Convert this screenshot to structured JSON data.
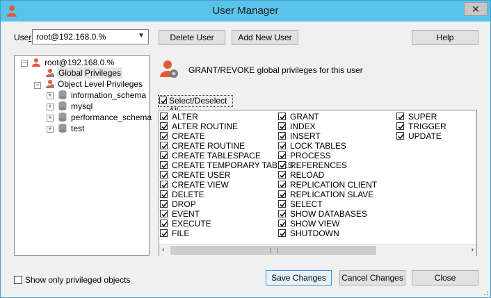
{
  "window": {
    "title": "User Manager",
    "close_label": "✕"
  },
  "user": {
    "label_pre": "Use",
    "label_u": "r",
    "selected": "root@192.168.0.%"
  },
  "buttons": {
    "delete_user": "Delete User",
    "add_new_user": "Add New User",
    "help": "Help",
    "save_changes": "Save Changes",
    "cancel_changes": "Cancel Changes",
    "close": "Close"
  },
  "tree": {
    "root": "root@192.168.0.%",
    "global": "Global Privileges",
    "object_level": "Object Level Privileges",
    "databases": [
      "information_schema",
      "mysql",
      "performance_schema",
      "test"
    ]
  },
  "header": {
    "text": "GRANT/REVOKE global privileges for this user"
  },
  "select_all": {
    "label": "Select/Deselect All",
    "checked": true
  },
  "privileges": {
    "col1": [
      "ALTER",
      "ALTER ROUTINE",
      "CREATE",
      "CREATE ROUTINE",
      "CREATE TABLESPACE",
      "CREATE TEMPORARY TABLES",
      "CREATE USER",
      "CREATE VIEW",
      "DELETE",
      "DROP",
      "EVENT",
      "EXECUTE",
      "FILE"
    ],
    "col2": [
      "GRANT",
      "INDEX",
      "INSERT",
      "LOCK TABLES",
      "PROCESS",
      "REFERENCES",
      "RELOAD",
      "REPLICATION CLIENT",
      "REPLICATION SLAVE",
      "SELECT",
      "SHOW DATABASES",
      "SHOW VIEW",
      "SHUTDOWN"
    ],
    "col3": [
      "SUPER",
      "TRIGGER",
      "UPDATE"
    ]
  },
  "footer": {
    "show_only_label": "Show only privileged objects",
    "show_only_checked": false
  },
  "colors": {
    "titlebar": "#5ac3ea",
    "user_icon": "#e05a3a"
  }
}
